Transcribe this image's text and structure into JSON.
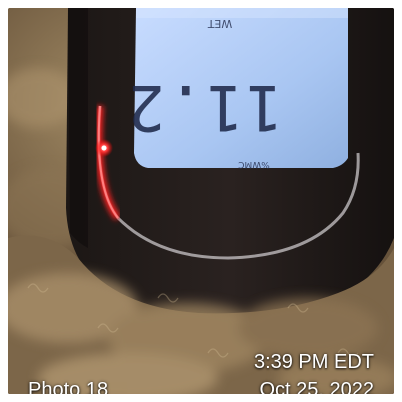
{
  "photo": {
    "label": "Photo 18",
    "time": "3:39 PM EDT",
    "date": "Oct 25, 2022"
  },
  "lcd": {
    "reading": "11.2",
    "top_text": "WET",
    "unit_text": "%WMC"
  }
}
